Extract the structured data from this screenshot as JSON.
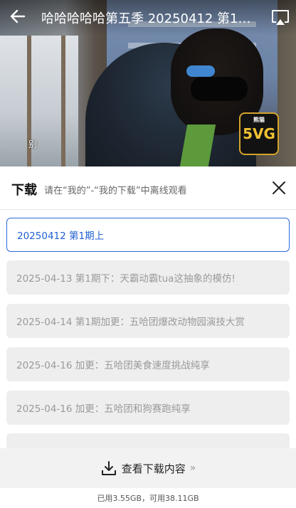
{
  "player": {
    "title": "哈哈哈哈哈第五季 20250412 第1期..",
    "subtitle_text": "别",
    "logo_text": "5VG",
    "logo_small_text": "熊猫"
  },
  "download_panel": {
    "title": "下载",
    "hint": "请在“我的”-“我的下载”中离线观看",
    "episodes": [
      {
        "label": "20250412 第1期上",
        "selected": true
      },
      {
        "label": "2025-04-13 第1期下：天霸动霸tua这抽象的模仿!",
        "selected": false
      },
      {
        "label": "2025-04-14 第1期加更：五哈团爆改动物园演技大赏",
        "selected": false
      },
      {
        "label": "2025-04-16 加更：五哈团美食速度挑战纯享",
        "selected": false
      },
      {
        "label": "2025-04-16 加更：五哈团和狗赛跑纯享",
        "selected": false
      },
      {
        "label": "",
        "selected": false
      }
    ],
    "view_downloads_label": "查看下载内容",
    "view_downloads_chevron": "»",
    "storage_text": "已用3.55GB，可用38.11GB"
  },
  "colors": {
    "accent": "#2b6ad8",
    "episode_bg": "#eeeeee",
    "bottom_bar_bg": "#f2f2f2"
  },
  "icons": {
    "back": "back-arrow-icon",
    "cast": "screen-cast-icon",
    "close": "close-icon",
    "download": "download-icon"
  }
}
